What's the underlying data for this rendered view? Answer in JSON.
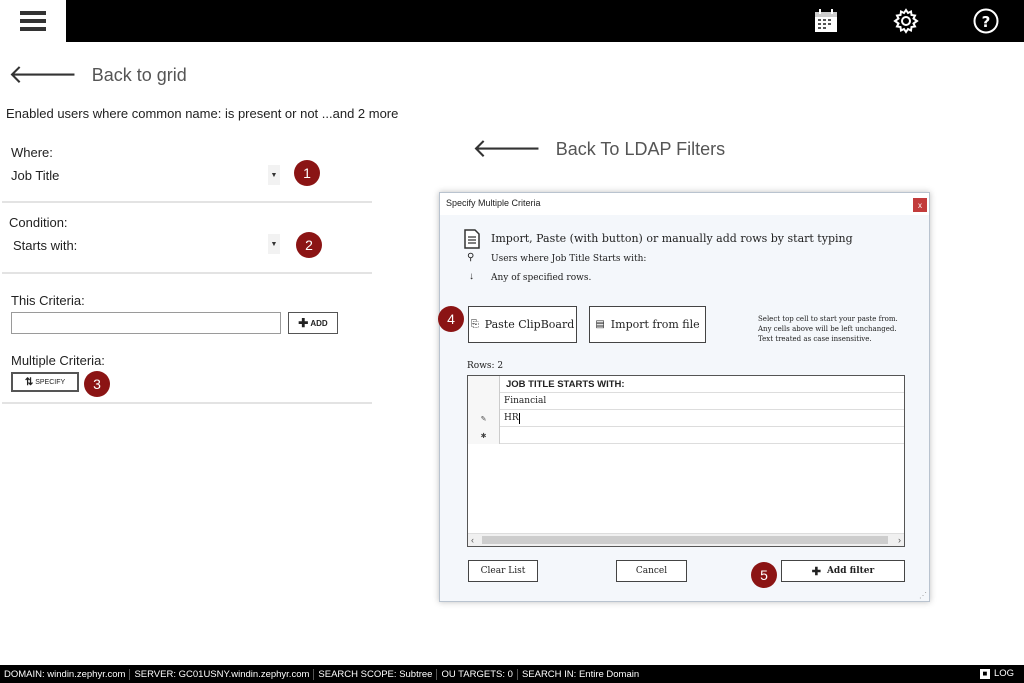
{
  "topbar": {
    "menu_icon": "hamburger-menu-icon",
    "icons": [
      "calendar-icon",
      "gear-icon",
      "help-circle-icon"
    ]
  },
  "left": {
    "back_label": "Back to grid",
    "summary": "Enabled users where common name:  is present or not ...and 2 more",
    "where_label": "Where:",
    "where_value": "Job Title",
    "condition_label": "Condition:",
    "condition_value": "Starts with:",
    "this_criteria_label": "This Criteria:",
    "this_criteria_value": "",
    "add_label": "ADD",
    "multiple_label": "Multiple Criteria:",
    "specify_label": "SPECIFY",
    "badges": [
      "1",
      "2",
      "3"
    ]
  },
  "right": {
    "back_label": "Back To LDAP Filters"
  },
  "dialog": {
    "title": "Specify Multiple Criteria",
    "close": "x",
    "instruction": "Import, Paste (with button) or manually add rows by start typing",
    "line2": "Users where Job Title Starts with:",
    "line3": "Any of specified rows.",
    "paste_label": "Paste ClipBoard",
    "import_label": "Import from file",
    "hint1": "Select top cell to start your paste from.",
    "hint2": "Any cells above will be left unchanged.",
    "hint3": "Text treated as case insensitive.",
    "rows_label": "Rows: 2",
    "column_header": "JOB TITLE STARTS WITH:",
    "rows": [
      "Financial",
      "HR",
      ""
    ],
    "clear_label": "Clear List",
    "cancel_label": "Cancel",
    "add_filter_label": "Add filter",
    "badges": [
      "4",
      "5"
    ]
  },
  "statusbar": {
    "domain_k": "DOMAIN:",
    "domain_v": "windin.zephyr.com",
    "server_k": "SERVER:",
    "server_v": "GC01USNY.windin.zephyr.com",
    "scope_k": "SEARCH SCOPE:",
    "scope_v": "Subtree",
    "ou_k": "OU TARGETS:",
    "ou_v": "0",
    "searchin_k": "SEARCH IN:",
    "searchin_v": "Entire Domain",
    "log": "LOG"
  },
  "colors": {
    "badge": "#8b1414",
    "topbar": "#000000",
    "dialog_bg": "#f4f7fb"
  }
}
